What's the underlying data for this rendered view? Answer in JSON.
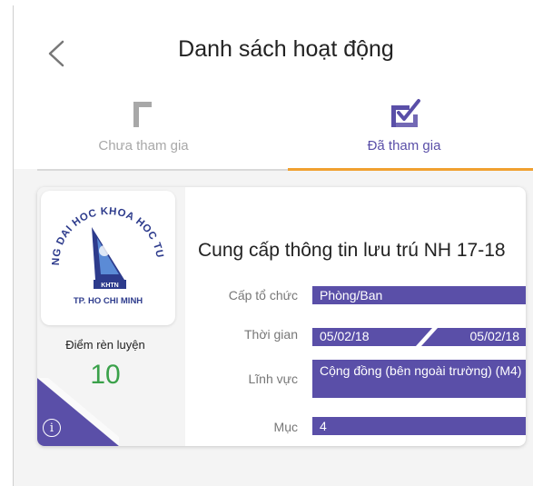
{
  "header": {
    "title": "Danh sách hoạt động"
  },
  "tabs": [
    {
      "label": "Chưa tham gia",
      "icon": "unchecked-box-icon"
    },
    {
      "label": "Đã tham gia",
      "icon": "checked-box-icon"
    }
  ],
  "colors": {
    "accent": "#5a4fa8",
    "tab_underline": "#f0a030",
    "score": "#3aa14a"
  },
  "activity": {
    "logo_text_top": "TRUONG DAI HOC KHOA HOC TU NHIEN",
    "logo_text_bottom": "TP. HO CHI MINH",
    "logo_abbr": "KHTN",
    "score_label": "Điểm rèn luyện",
    "score_value": "10",
    "title": "Cung cấp thông tin lưu trú NH 17-18",
    "organizer_label": "Cấp tổ chức",
    "organizer_value": "Phòng/Ban",
    "time_label": "Thời gian",
    "start_date": "05/02/18",
    "end_date": "05/02/18",
    "field_label": "Lĩnh vực",
    "field_value": "Cộng đồng (bên ngoài trường) (M4)",
    "item_label": "Mục",
    "item_value": "4"
  }
}
